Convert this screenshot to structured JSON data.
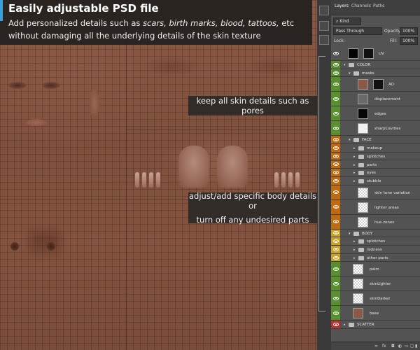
{
  "banner": {
    "title": "Easily adjustable PSD file",
    "line1_prefix": "Add personalized details such as ",
    "line1_italic": "scars, birth marks, blood, tattoos,",
    "line1_suffix": " etc",
    "line2": "without damaging all the underlying details of the skin texture"
  },
  "callouts": {
    "pores": "keep all skin details such as pores",
    "adjust_line1": "adjust/add specific body details or",
    "adjust_line2": "turn off any undesired parts"
  },
  "panel": {
    "tabs": [
      "Layers",
      "Channels",
      "Paths"
    ],
    "kind_label": "Kind",
    "blend_mode": "Pass Through",
    "opacity_label": "Opacity:",
    "opacity_value": "100%",
    "lock_label": "Lock:",
    "fill_label": "Fill:",
    "fill_value": "100%"
  },
  "layers": [
    {
      "name": "UV",
      "eye_color": "#535353",
      "indent": 0,
      "type": "layer",
      "thumb": "black"
    },
    {
      "name": "COLOR",
      "eye_color": "#5a8f2f",
      "indent": 0,
      "type": "group"
    },
    {
      "name": "masks",
      "eye_color": "#5a8f2f",
      "indent": 1,
      "type": "group"
    },
    {
      "name": "AO",
      "eye_color": "#5a8f2f",
      "indent": 2,
      "type": "layer",
      "thumb": "skin"
    },
    {
      "name": "displacement",
      "eye_color": "#5a8f2f",
      "indent": 2,
      "type": "layer",
      "thumb": "gray"
    },
    {
      "name": "edges",
      "eye_color": "#5a8f2f",
      "indent": 2,
      "type": "layer",
      "thumb": "black"
    },
    {
      "name": "sharpCavities",
      "eye_color": "#5a8f2f",
      "indent": 2,
      "type": "layer",
      "thumb": "white"
    },
    {
      "name": "FACE",
      "eye_color": "#c0690f",
      "indent": 1,
      "type": "group"
    },
    {
      "name": "makeup",
      "eye_color": "#c0690f",
      "indent": 2,
      "type": "group"
    },
    {
      "name": "splotches",
      "eye_color": "#c0690f",
      "indent": 2,
      "type": "group"
    },
    {
      "name": "parts",
      "eye_color": "#c0690f",
      "indent": 2,
      "type": "group"
    },
    {
      "name": "eyes",
      "eye_color": "#c0690f",
      "indent": 2,
      "type": "group"
    },
    {
      "name": "stubble",
      "eye_color": "#c0690f",
      "indent": 2,
      "type": "group"
    },
    {
      "name": "skin tone variation",
      "eye_color": "#c0690f",
      "indent": 2,
      "type": "layer",
      "thumb": "check"
    },
    {
      "name": "lighter areas",
      "eye_color": "#c0690f",
      "indent": 2,
      "type": "layer",
      "thumb": "check"
    },
    {
      "name": "hue zones",
      "eye_color": "#c0690f",
      "indent": 2,
      "type": "layer",
      "thumb": "check"
    },
    {
      "name": "BODY",
      "eye_color": "#c9a227",
      "indent": 1,
      "type": "group"
    },
    {
      "name": "splotches",
      "eye_color": "#c9a227",
      "indent": 2,
      "type": "group"
    },
    {
      "name": "redness",
      "eye_color": "#c9a227",
      "indent": 2,
      "type": "group"
    },
    {
      "name": "other parts",
      "eye_color": "#c9a227",
      "indent": 2,
      "type": "group"
    },
    {
      "name": "palm",
      "eye_color": "#5a8f2f",
      "indent": 1,
      "type": "layer",
      "thumb": "check"
    },
    {
      "name": "skinLighter",
      "eye_color": "#5a8f2f",
      "indent": 1,
      "type": "layer",
      "thumb": "check"
    },
    {
      "name": "skinDarker",
      "eye_color": "#5a8f2f",
      "indent": 1,
      "type": "layer",
      "thumb": "check"
    },
    {
      "name": "base",
      "eye_color": "#5a8f2f",
      "indent": 1,
      "type": "layer",
      "thumb": "skin"
    },
    {
      "name": "SCATTER",
      "eye_color": "#b83232",
      "indent": 0,
      "type": "group"
    }
  ],
  "bottom_icons": [
    "link-icon",
    "fx-icon",
    "mask-icon",
    "adjustment-icon",
    "new-group-icon",
    "new-layer-icon",
    "trash-icon"
  ]
}
